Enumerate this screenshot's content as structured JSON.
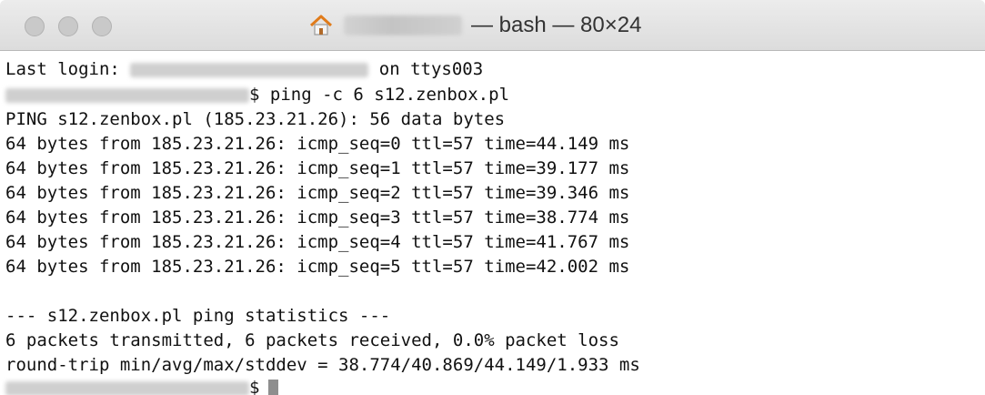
{
  "window": {
    "title": "— bash — 80×24"
  },
  "terminal": {
    "login_prefix": "Last login:",
    "login_suffix": "on ttys003",
    "prompt_symbol": "$",
    "command": "ping -c 6 s12.zenbox.pl",
    "output": [
      "PING s12.zenbox.pl (185.23.21.26): 56 data bytes",
      "64 bytes from 185.23.21.26: icmp_seq=0 ttl=57 time=44.149 ms",
      "64 bytes from 185.23.21.26: icmp_seq=1 ttl=57 time=39.177 ms",
      "64 bytes from 185.23.21.26: icmp_seq=2 ttl=57 time=39.346 ms",
      "64 bytes from 185.23.21.26: icmp_seq=3 ttl=57 time=38.774 ms",
      "64 bytes from 185.23.21.26: icmp_seq=4 ttl=57 time=41.767 ms",
      "64 bytes from 185.23.21.26: icmp_seq=5 ttl=57 time=42.002 ms",
      "",
      "--- s12.zenbox.pl ping statistics ---",
      "6 packets transmitted, 6 packets received, 0.0% packet loss",
      "round-trip min/avg/max/stddev = 38.774/40.869/44.149/1.933 ms"
    ]
  },
  "icons": {
    "close": "traffic-light-close",
    "minimize": "traffic-light-minimize",
    "maximize": "traffic-light-maximize",
    "home": "home-icon"
  },
  "colors": {
    "titlebar": "#e3e3e3",
    "traffic_light": "#c9c9c9",
    "terminal_bg": "#ffffff",
    "terminal_text": "#111111",
    "cursor": "#8e8e8e",
    "home_roof": "#e07b1a"
  }
}
